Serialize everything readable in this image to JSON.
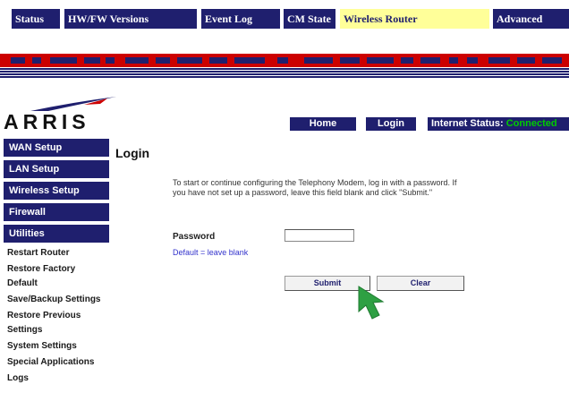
{
  "tabs": [
    {
      "label": "Status",
      "active": false
    },
    {
      "label": "HW/FW Versions",
      "active": false
    },
    {
      "label": "Event Log",
      "active": false
    },
    {
      "label": "CM State",
      "active": false
    },
    {
      "label": "Wireless Router",
      "active": true
    },
    {
      "label": "Advanced",
      "active": false
    }
  ],
  "logo": {
    "text": "ARRIS"
  },
  "header": {
    "home_label": "Home",
    "login_label": "Login",
    "internet_status_label": "Internet Status: ",
    "internet_status_value": "Connected"
  },
  "sidebar": {
    "sections": [
      {
        "label": "WAN Setup"
      },
      {
        "label": "LAN Setup"
      },
      {
        "label": "Wireless Setup"
      },
      {
        "label": "Firewall"
      },
      {
        "label": "Utilities"
      }
    ],
    "utilities_items": [
      {
        "label": "Restart Router"
      },
      {
        "label": "Restore Factory Default"
      },
      {
        "label": "Save/Backup Settings"
      },
      {
        "label": "Restore Previous Settings"
      },
      {
        "label": "System Settings"
      },
      {
        "label": "Special Applications"
      },
      {
        "label": "Logs"
      }
    ]
  },
  "main": {
    "title": "Login",
    "intro": "To start or continue configuring the Telephony Modem, log in with a password. If you have not set up a password, leave this field blank and click \"Submit.\"",
    "password_label": "Password",
    "password_value": "",
    "password_hint": "Default = leave blank",
    "submit_label": "Submit",
    "clear_label": "Clear"
  },
  "colors": {
    "nav_bg": "#1f1f6e",
    "active_tab_bg": "#ffff99",
    "band_red": "#cc0000",
    "connected_green": "#00cc00",
    "pointer_green": "#2ea043"
  }
}
